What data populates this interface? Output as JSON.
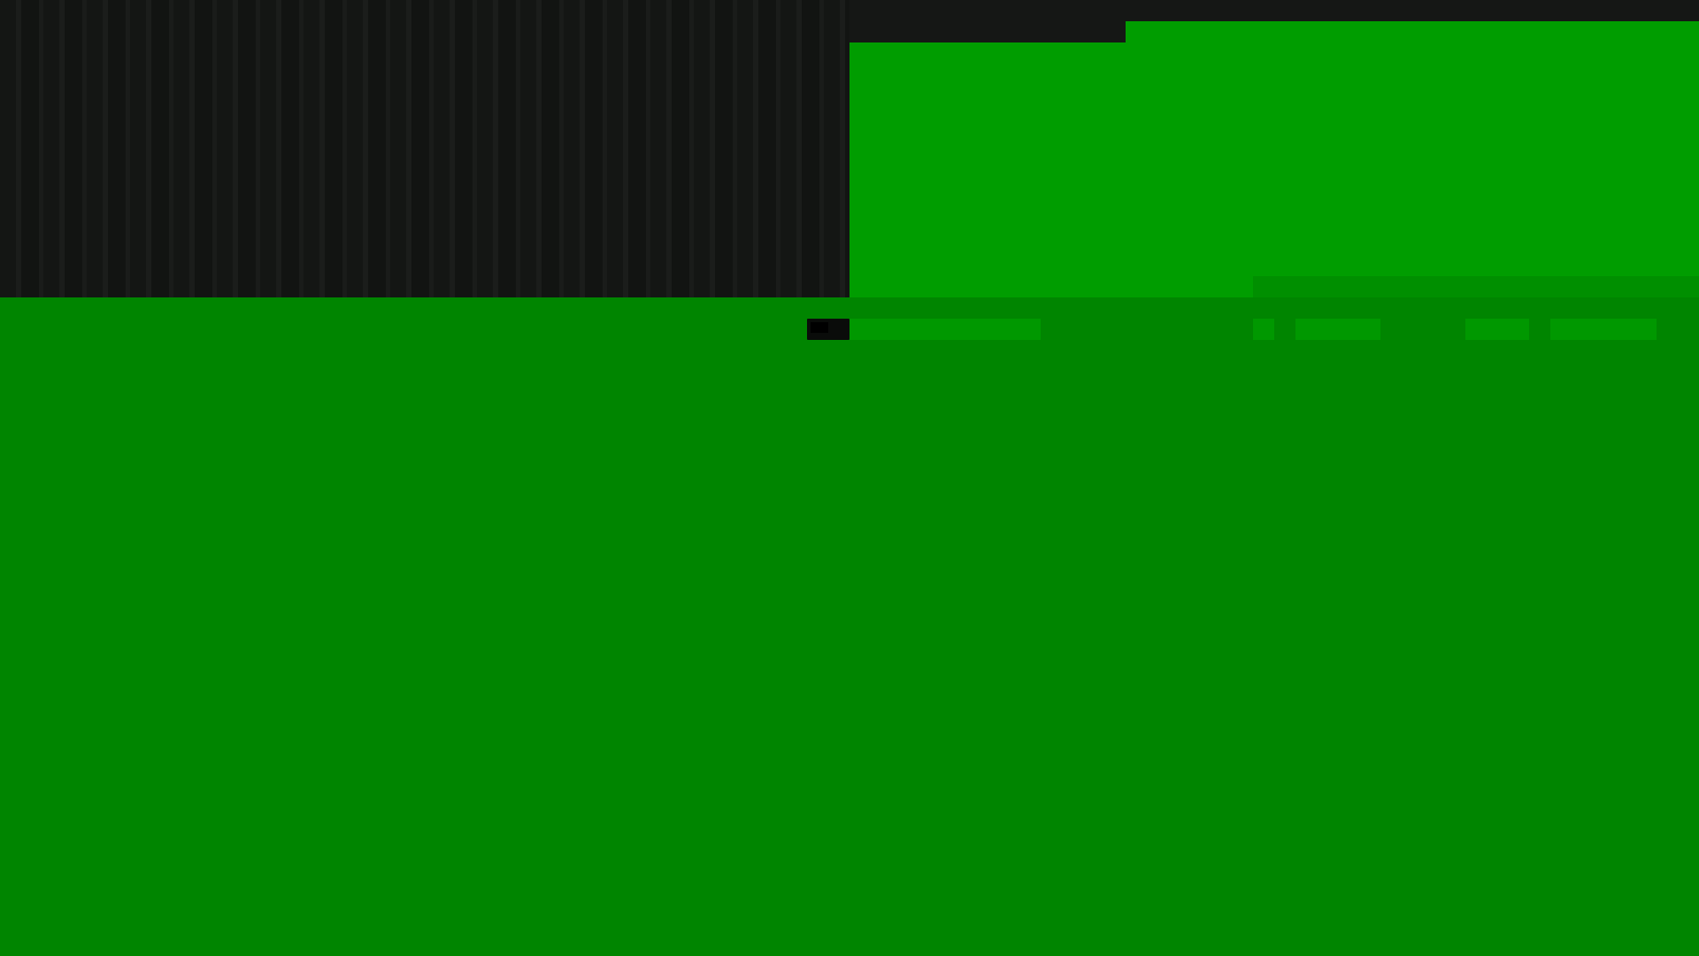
{
  "colors": {
    "background": "#008500",
    "dark_panel": "#141614",
    "bright_green": "#009d00",
    "control_green": "#009800",
    "dark_chip": "#0a0c0a"
  },
  "controls": [
    {
      "icon": "dark-chip-icon"
    },
    {
      "icon": "green-bar"
    },
    {
      "icon": "green-bar"
    },
    {
      "icon": "green-bar"
    },
    {
      "icon": "green-bar"
    },
    {
      "icon": "green-bar"
    }
  ]
}
